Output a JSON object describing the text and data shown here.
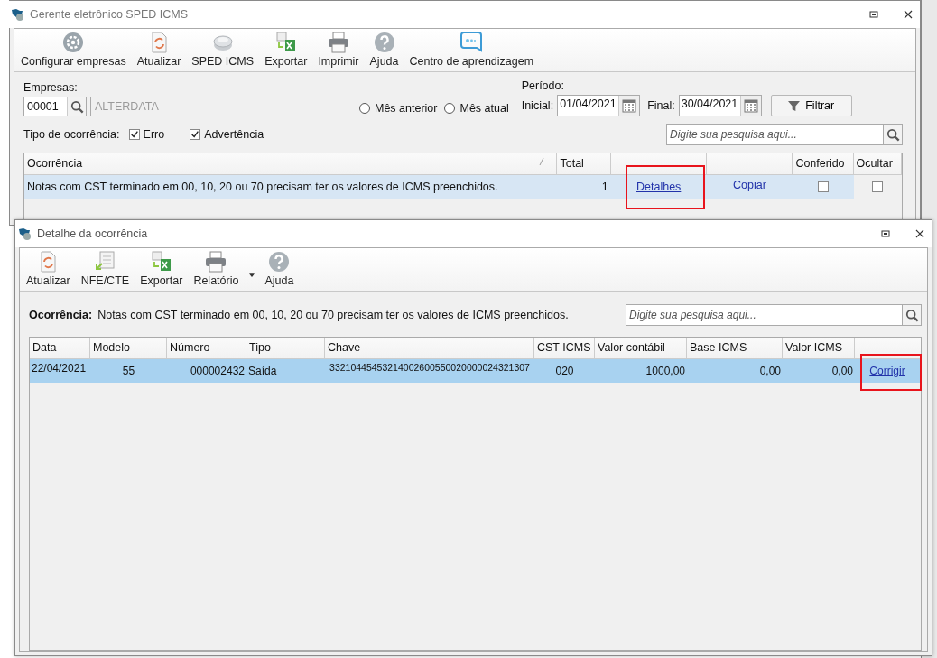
{
  "main_window": {
    "title": "Gerente eletrônico SPED ICMS",
    "toolbar": [
      {
        "label": "Configurar empresas"
      },
      {
        "label": "Atualizar"
      },
      {
        "label": "SPED ICMS"
      },
      {
        "label": "Exportar"
      },
      {
        "label": "Imprimir"
      },
      {
        "label": "Ajuda"
      },
      {
        "label": "Centro de aprendizagem"
      }
    ],
    "companies_label": "Empresas:",
    "company_code": "00001",
    "company_name": "ALTERDATA",
    "period_options": [
      {
        "label": "Mês anterior",
        "selected": false
      },
      {
        "label": "Mês atual",
        "selected": false
      }
    ],
    "period_label": "Período:",
    "initial_label": "Inicial:",
    "initial_date": "01/04/2021",
    "final_label": "Final:",
    "final_date": "30/04/2021",
    "filter_button": "Filtrar",
    "occurrence_type_label": "Tipo de ocorrência:",
    "occurrence_types": [
      {
        "label": "Erro",
        "checked": true
      },
      {
        "label": "Advertência",
        "checked": true
      }
    ],
    "search": {
      "placeholder": "Digite sua pesquisa aqui..."
    },
    "table": {
      "columns": [
        {
          "label": "Ocorrência",
          "sorted": true
        },
        {
          "label": "Total"
        },
        {},
        {},
        {
          "label": "Conferido"
        },
        {
          "label": "Ocultar"
        }
      ],
      "rows": [
        {
          "occurrence": "Notas com CST terminado em 00, 10, 20 ou 70 precisam ter os valores de ICMS preenchidos.",
          "total": "1",
          "details_link": "Detalhes",
          "details_highlighted": true,
          "copy_link": "Copiar",
          "checked_off": false,
          "hidden": false,
          "selected": true
        }
      ]
    }
  },
  "detail_window": {
    "title": "Detalhe da ocorrência",
    "toolbar": [
      {
        "label": "Atualizar",
        "dropdown": false
      },
      {
        "label": "NFE/CTE",
        "dropdown": false
      },
      {
        "label": "Exportar",
        "dropdown": false
      },
      {
        "label": "Relatório",
        "dropdown": true
      },
      {
        "label": "Ajuda",
        "dropdown": false
      }
    ],
    "occurrence_label": "Ocorrência:",
    "occurrence_text": "Notas com CST terminado em 00, 10, 20 ou 70 precisam ter os valores de ICMS preenchidos.",
    "search": {
      "placeholder": "Digite sua pesquisa aqui..."
    },
    "table": {
      "columns": [
        {
          "label": "Data"
        },
        {
          "label": "Modelo"
        },
        {
          "label": "Número"
        },
        {
          "label": "Tipo"
        },
        {
          "label": "Chave"
        },
        {
          "label": "CST ICMS"
        },
        {
          "label": "Valor contábil"
        },
        {
          "label": "Base ICMS"
        },
        {
          "label": "Valor ICMS"
        },
        {}
      ],
      "rows": [
        {
          "cells": [
            "22/04/2021",
            "55",
            "000002432",
            "Saída",
            "33210445453214002600550020000024321307",
            "020",
            "1000,00",
            "0,00",
            "0,00"
          ],
          "action_link": "Corrigir",
          "action_highlighted": true,
          "selected": true
        }
      ]
    }
  }
}
